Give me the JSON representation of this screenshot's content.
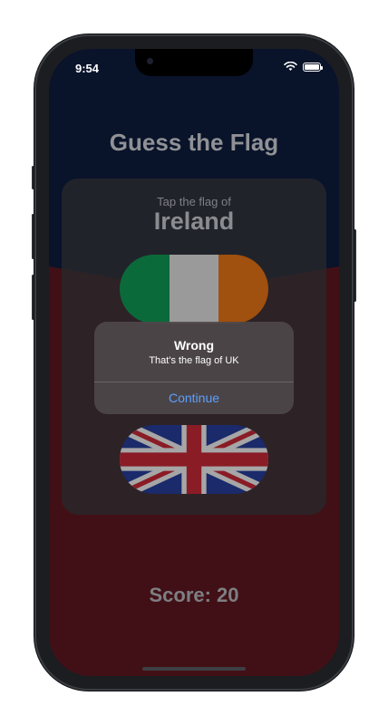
{
  "status_bar": {
    "time": "9:54"
  },
  "app": {
    "title": "Guess the Flag",
    "prompt": "Tap the flag of",
    "country": "Ireland",
    "score_label": "Score: 20"
  },
  "flags": [
    {
      "name": "Ireland",
      "colors": [
        "#0b6a3a",
        "#9a9a9a",
        "#a0500f"
      ]
    },
    {
      "name": "UK"
    }
  ],
  "alert": {
    "title": "Wrong",
    "message": "That's the flag of UK",
    "button_label": "Continue"
  },
  "colors": {
    "background_top": "#0f1f45",
    "background_bottom": "#6a1a25",
    "accent": "#5aa0ff"
  }
}
